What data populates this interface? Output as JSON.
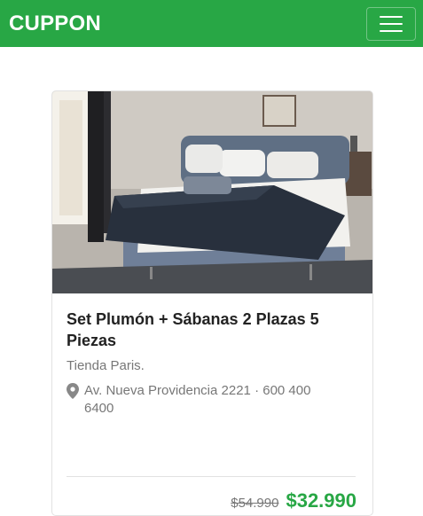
{
  "navbar": {
    "brand": "CUPPON",
    "menu_icon": "hamburger-icon",
    "colors": {
      "background": "#28a745",
      "text": "#ffffff"
    }
  },
  "deal": {
    "image_icon": "bed-product-photo",
    "title": "Set Plumón + Sábanas 2 Plazas 5 Piezas",
    "store": "Tienda Paris.",
    "location_icon": "map-pin-icon",
    "address": "Av. Nueva Providencia 2221 · 600 400 6400",
    "old_price": "$54.990",
    "new_price": "$32.990",
    "colors": {
      "price": "#28a745",
      "muted": "#777777"
    }
  }
}
